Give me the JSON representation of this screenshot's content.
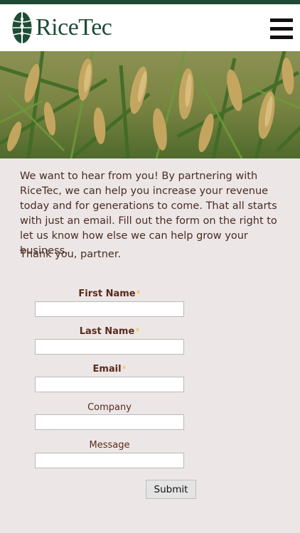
{
  "header": {
    "brand": "RiceTec",
    "menu_icon": "hamburger-menu-icon",
    "brand_color": "#1e4d36"
  },
  "hero": {
    "image": "rice-field-photo"
  },
  "intro": {
    "text": "We want to hear from you! By partnering with RiceTec, we can help you increase your revenue today and for generations to come. That all starts with just an email. Fill out the form on the right to let us know how else we can help grow your business.",
    "thanks": "Thank you, partner."
  },
  "form": {
    "first_name_label": "First Name",
    "last_name_label": "Last Name",
    "email_label": "Email",
    "company_label": "Company",
    "message_label": "Message",
    "required_mark": "*",
    "first_name_value": "",
    "last_name_value": "",
    "email_value": "",
    "company_value": "",
    "message_value": "",
    "submit_label": "Submit"
  }
}
